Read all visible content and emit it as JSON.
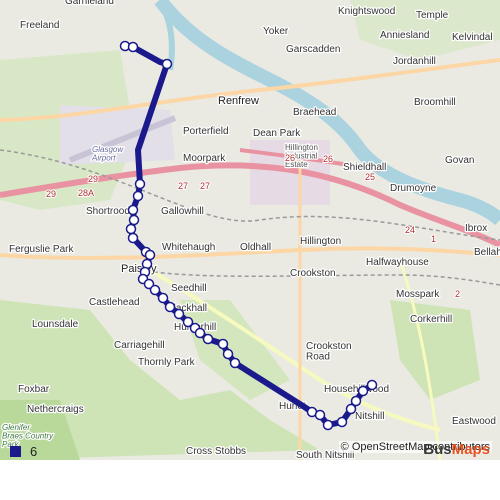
{
  "map": {
    "place_labels": [
      {
        "id": "freeland",
        "text": "Freeland"
      },
      {
        "id": "garnieland",
        "text": "Garnieland"
      },
      {
        "id": "knightswood",
        "text": "Knightswood"
      },
      {
        "id": "temple",
        "text": "Temple"
      },
      {
        "id": "yoker",
        "text": "Yoker"
      },
      {
        "id": "anniesland",
        "text": "Anniesland"
      },
      {
        "id": "kelvindale",
        "text": "Kelvindal"
      },
      {
        "id": "garscadden",
        "text": "Garscadden"
      },
      {
        "id": "jordanhill",
        "text": "Jordanhill"
      },
      {
        "id": "renfrew",
        "text": "Renfrew"
      },
      {
        "id": "braehead",
        "text": "Braehead"
      },
      {
        "id": "broomhill",
        "text": "Broomhill"
      },
      {
        "id": "porterfield",
        "text": "Porterfield"
      },
      {
        "id": "dean-park",
        "text": "Dean Park"
      },
      {
        "id": "glasgow-airport",
        "text": "Glasgow\nAirport"
      },
      {
        "id": "moorpark",
        "text": "Moorpark"
      },
      {
        "id": "shieldhall",
        "text": "Shieldhall"
      },
      {
        "id": "govan",
        "text": "Govan"
      },
      {
        "id": "hillington-estate",
        "text": "Hillington\nIndustrial\nEstate"
      },
      {
        "id": "shortroods",
        "text": "Shortroods"
      },
      {
        "id": "gallowhill",
        "text": "Gallowhill"
      },
      {
        "id": "drumoyne",
        "text": "Drumoyne"
      },
      {
        "id": "ibrox",
        "text": "Ibrox"
      },
      {
        "id": "ferguslie-park",
        "text": "Ferguslie Park"
      },
      {
        "id": "whitehaugh",
        "text": "Whitehaugh"
      },
      {
        "id": "oldhall",
        "text": "Oldhall"
      },
      {
        "id": "hillington",
        "text": "Hillington"
      },
      {
        "id": "bellahouston",
        "text": "Bellaho"
      },
      {
        "id": "paisley",
        "text": "Paisley"
      },
      {
        "id": "halfwayhouse",
        "text": "Halfwayhouse"
      },
      {
        "id": "crookston",
        "text": "Crookston"
      },
      {
        "id": "seedhill",
        "text": "Seedhill"
      },
      {
        "id": "mosspark",
        "text": "Mosspark"
      },
      {
        "id": "castlehead",
        "text": "Castlehead"
      },
      {
        "id": "blackhall",
        "text": "Blackhall"
      },
      {
        "id": "corkerhill",
        "text": "Corkerhill"
      },
      {
        "id": "lounsdale",
        "text": "Lounsdale"
      },
      {
        "id": "hunterhill",
        "text": "Hunterhill"
      },
      {
        "id": "carriagehill",
        "text": "Carriagehill"
      },
      {
        "id": "crookston-road",
        "text": "Crookston\nRoad"
      },
      {
        "id": "thornly-park",
        "text": "Thornly Park"
      },
      {
        "id": "foxbar",
        "text": "Foxbar"
      },
      {
        "id": "househillwood",
        "text": "Househillwood"
      },
      {
        "id": "nethercraigs",
        "text": "Nethercraigs"
      },
      {
        "id": "hurlet",
        "text": "Hurlet"
      },
      {
        "id": "nitshill",
        "text": "Nitshill"
      },
      {
        "id": "eastwood",
        "text": "Eastwood"
      },
      {
        "id": "glenifer",
        "text": "Glenifer\nBraes Country\nPark"
      },
      {
        "id": "cross-stobbs",
        "text": "Cross Stobbs"
      },
      {
        "id": "south-nitshill",
        "text": "South Nitshill"
      }
    ],
    "road_labels": [
      "29",
      "28A",
      "29",
      "27",
      "27",
      "26",
      "26",
      "25",
      "24",
      "1",
      "2"
    ],
    "route": {
      "color": "#1a1a8c",
      "stops": 30
    }
  },
  "attribution": "© OpenStreetMap contributors",
  "legend": {
    "swatch_color": "#1a1a8c",
    "label": "6"
  },
  "brand": {
    "part1": "Bus",
    "part2": "Maps"
  }
}
